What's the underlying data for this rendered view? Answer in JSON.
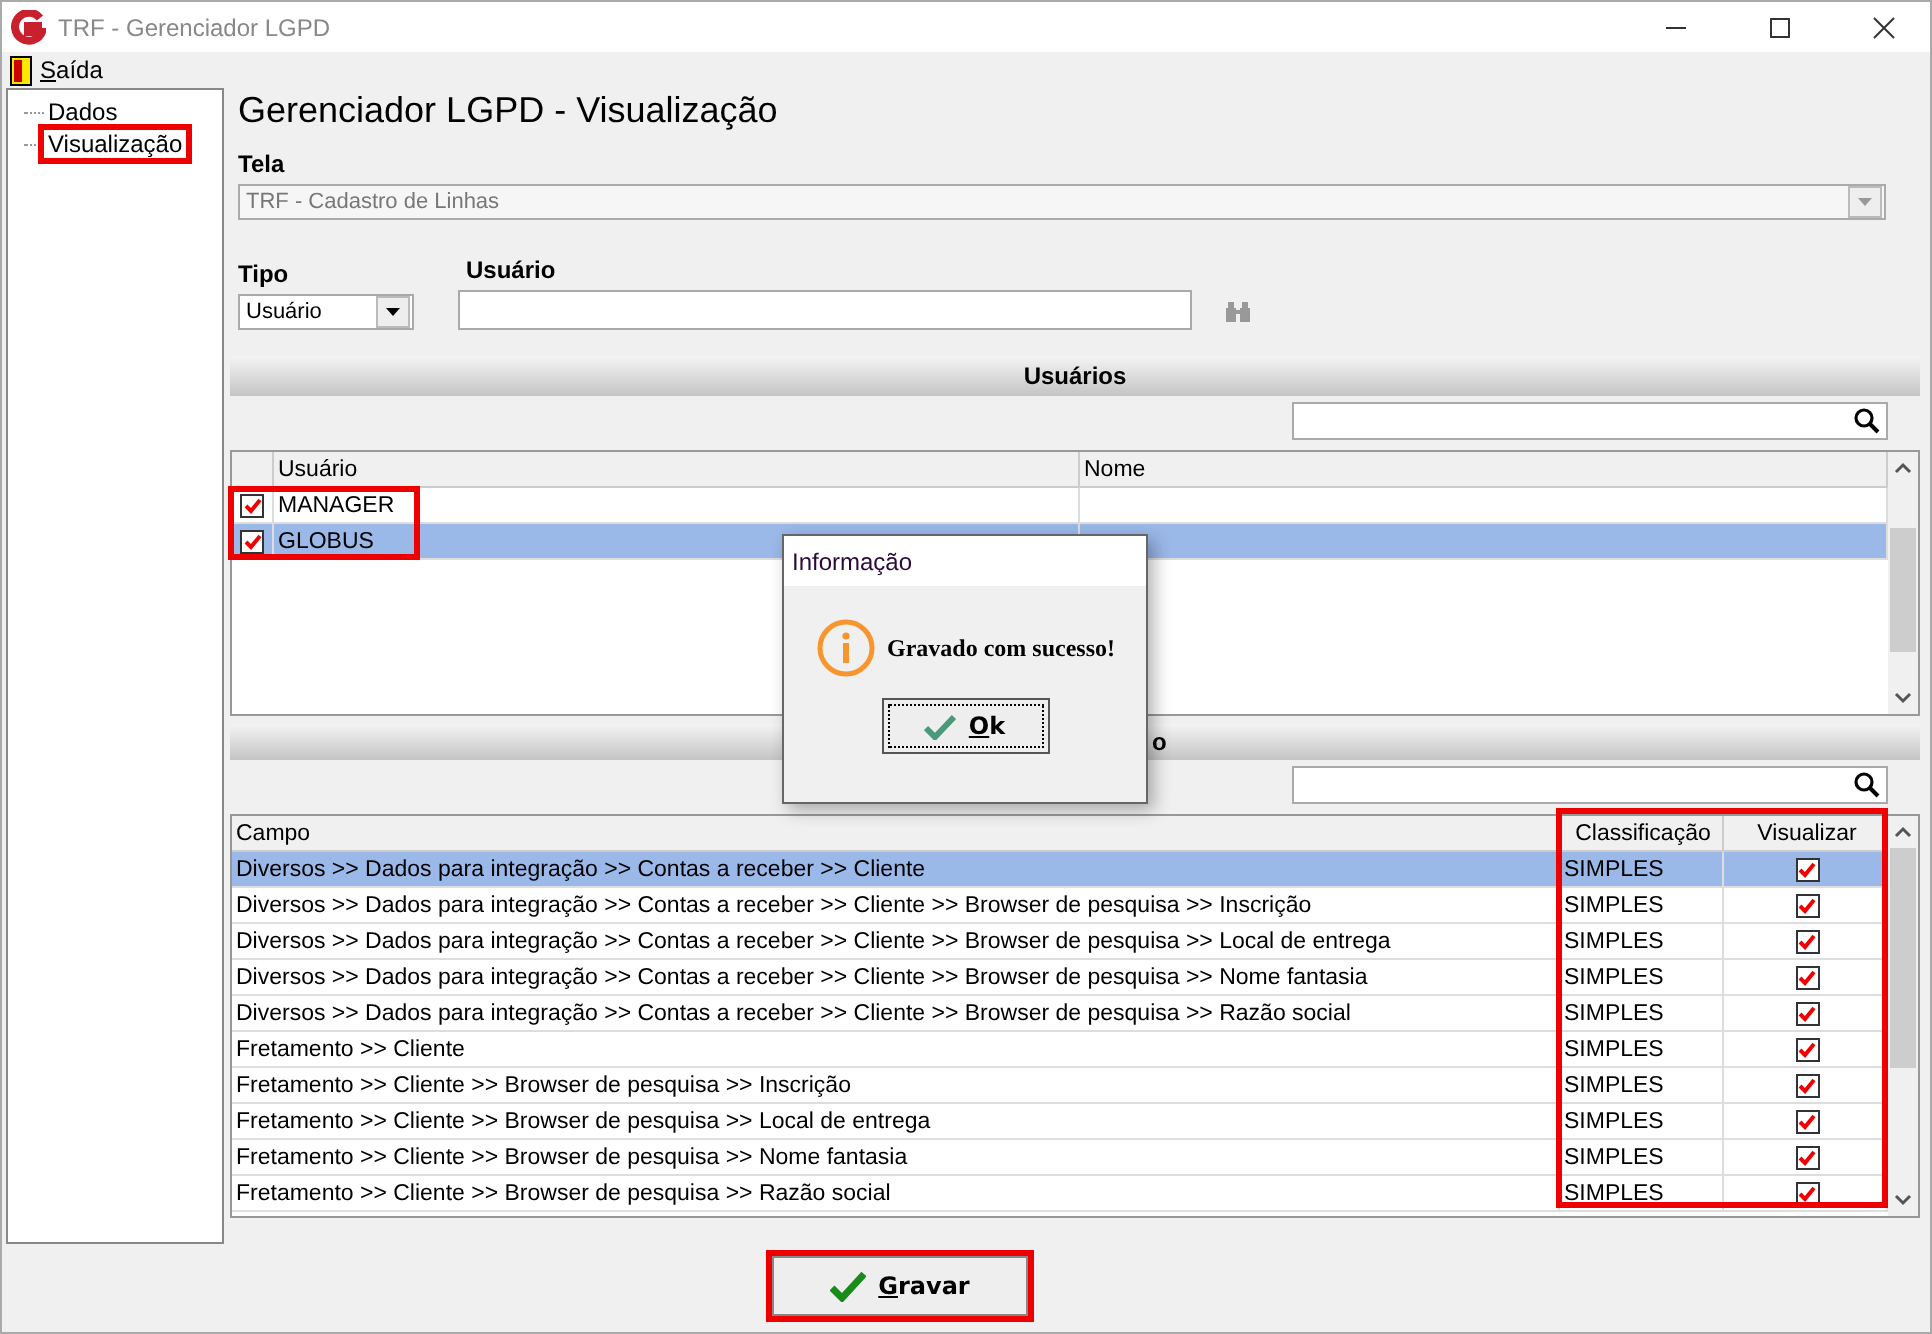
{
  "window": {
    "title": "TRF - Gerenciador LGPD"
  },
  "menu": [
    {
      "label": "Saída"
    }
  ],
  "tree": [
    {
      "label": "Dados",
      "selected": false,
      "highlighted": false
    },
    {
      "label": "Visualização",
      "selected": false,
      "highlighted": true
    }
  ],
  "page_title": "Gerenciador LGPD - Visualização",
  "tela": {
    "label": "Tela",
    "value": "TRF - Cadastro de Linhas",
    "disabled": true
  },
  "tipo": {
    "label": "Tipo",
    "value": "Usuário"
  },
  "usuario": {
    "label": "Usuário"
  },
  "users_section": {
    "title": "Usuários",
    "columns": [
      "Usuário",
      "Nome"
    ],
    "highlighted": true,
    "rows": [
      {
        "checked": true,
        "name": "MANAGER",
        "selected": false
      },
      {
        "checked": true,
        "name": "GLOBUS",
        "selected": true
      }
    ]
  },
  "fields_section": {
    "title_fragment": "o",
    "columns": [
      "Campo",
      "Classificação",
      "Visualizar"
    ],
    "highlighted": true,
    "rows": [
      {
        "campo": "Diversos >> Dados para integração >> Contas a receber >> Cliente",
        "classificacao": "SIMPLES",
        "visualizar": true,
        "selected": true
      },
      {
        "campo": "Diversos >> Dados para integração >> Contas a receber >> Cliente >> Browser de pesquisa >> Inscrição",
        "classificacao": "SIMPLES",
        "visualizar": true,
        "selected": false
      },
      {
        "campo": "Diversos >> Dados para integração >> Contas a receber >> Cliente >> Browser de pesquisa >> Local de entrega",
        "classificacao": "SIMPLES",
        "visualizar": true,
        "selected": false
      },
      {
        "campo": "Diversos >> Dados para integração >> Contas a receber >> Cliente >> Browser de pesquisa >> Nome fantasia",
        "classificacao": "SIMPLES",
        "visualizar": true,
        "selected": false
      },
      {
        "campo": "Diversos >> Dados para integração >> Contas a receber >> Cliente >> Browser de pesquisa >> Razão social",
        "classificacao": "SIMPLES",
        "visualizar": true,
        "selected": false
      },
      {
        "campo": "Fretamento >> Cliente",
        "classificacao": "SIMPLES",
        "visualizar": true,
        "selected": false
      },
      {
        "campo": "Fretamento >> Cliente >> Browser de pesquisa >> Inscrição",
        "classificacao": "SIMPLES",
        "visualizar": true,
        "selected": false
      },
      {
        "campo": "Fretamento >> Cliente >> Browser de pesquisa >> Local de entrega",
        "classificacao": "SIMPLES",
        "visualizar": true,
        "selected": false
      },
      {
        "campo": "Fretamento >> Cliente >> Browser de pesquisa >> Nome fantasia",
        "classificacao": "SIMPLES",
        "visualizar": true,
        "selected": false
      },
      {
        "campo": "Fretamento >> Cliente >> Browser de pesquisa >> Razão social",
        "classificacao": "SIMPLES",
        "visualizar": true,
        "selected": false
      }
    ]
  },
  "save_button": {
    "label": "Gravar",
    "highlighted": true
  },
  "dialog": {
    "title": "Informação",
    "message": "Gravado com sucesso!",
    "button": {
      "label": "Ok"
    }
  }
}
